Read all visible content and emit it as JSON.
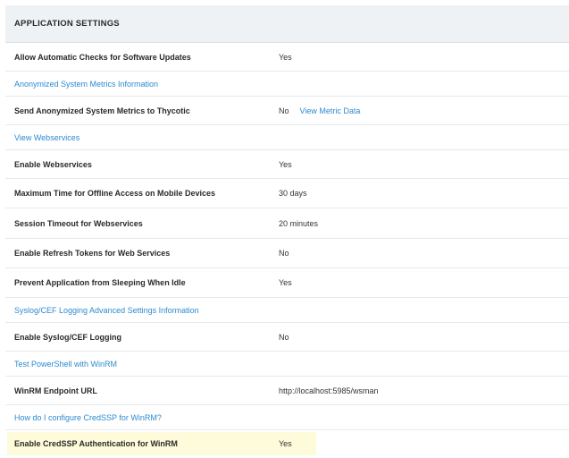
{
  "section": {
    "title": "APPLICATION SETTINGS"
  },
  "rows": [
    {
      "type": "setting",
      "label": "Allow Automatic Checks for Software Updates",
      "value": "Yes"
    },
    {
      "type": "link",
      "label": "Anonymized System Metrics Information"
    },
    {
      "type": "setting",
      "label": "Send Anonymized System Metrics to Thycotic",
      "value": "No",
      "extra_link": "View Metric Data"
    },
    {
      "type": "link",
      "label": "View Webservices"
    },
    {
      "type": "setting",
      "label": "Enable Webservices",
      "value": "Yes"
    },
    {
      "type": "setting",
      "label": "Maximum Time for Offline Access on Mobile Devices",
      "value": "30 days"
    },
    {
      "type": "setting",
      "label": "Session Timeout for Webservices",
      "value": "20 minutes"
    },
    {
      "type": "setting",
      "label": "Enable Refresh Tokens for Web Services",
      "value": "No"
    },
    {
      "type": "setting",
      "label": "Prevent Application from Sleeping When Idle",
      "value": "Yes"
    },
    {
      "type": "link",
      "label": "Syslog/CEF Logging Advanced Settings Information"
    },
    {
      "type": "setting",
      "label": "Enable Syslog/CEF Logging",
      "value": "No"
    },
    {
      "type": "link",
      "label": "Test PowerShell with WinRM"
    },
    {
      "type": "setting",
      "label": "WinRM Endpoint URL",
      "value": "http://localhost:5985/wsman"
    },
    {
      "type": "link",
      "label": "How do I configure CredSSP for WinRM?"
    },
    {
      "type": "setting",
      "label": "Enable CredSSP Authentication for WinRM",
      "value": "Yes",
      "highlighted": true
    }
  ],
  "colors": {
    "link": "#2d8ad0",
    "header_bg": "#eef2f5",
    "highlight": "#fdfbd9"
  }
}
